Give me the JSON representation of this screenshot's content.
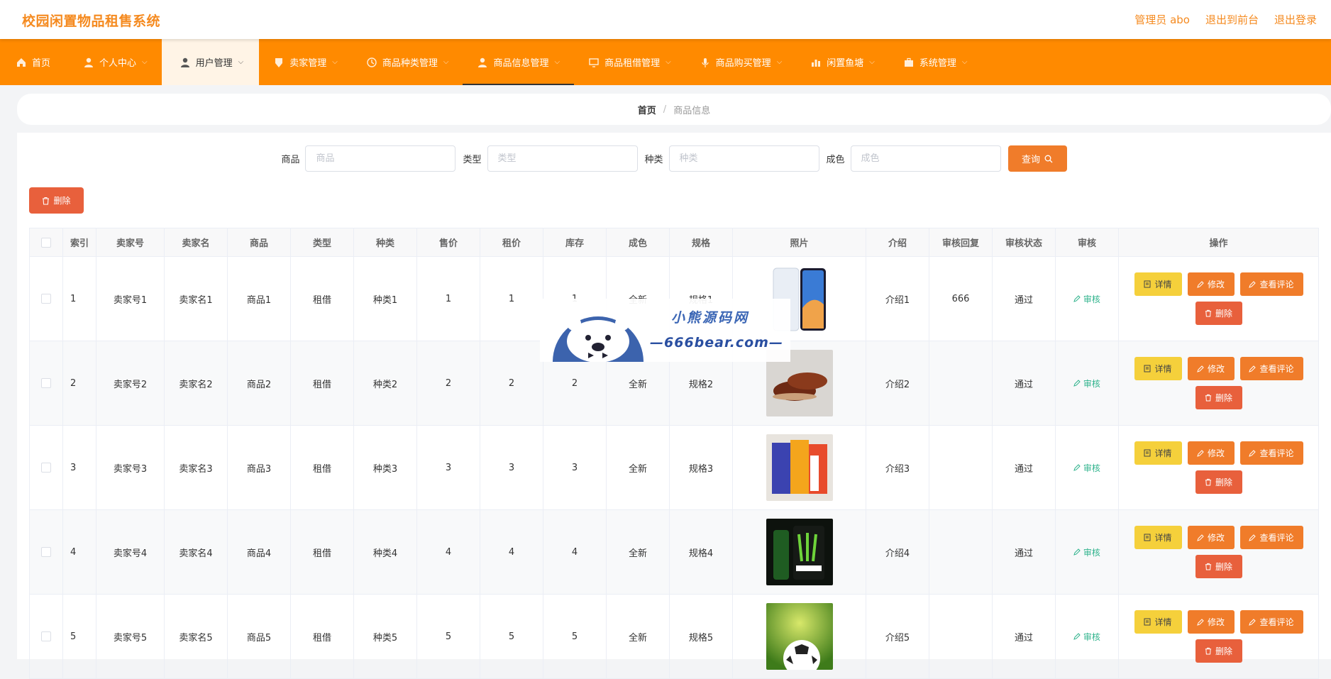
{
  "header": {
    "app_title": "校园闲置物品租售系统",
    "admin_label": "管理员 abo",
    "front_link": "退出到前台",
    "logout_link": "退出登录"
  },
  "nav": [
    {
      "label": "首页",
      "icon": "home-icon"
    },
    {
      "label": "个人中心",
      "icon": "user-icon"
    },
    {
      "label": "用户管理",
      "icon": "user-icon"
    },
    {
      "label": "卖家管理",
      "icon": "shield-icon"
    },
    {
      "label": "商品种类管理",
      "icon": "clock-icon"
    },
    {
      "label": "商品信息管理",
      "icon": "user-icon"
    },
    {
      "label": "商品租借管理",
      "icon": "monitor-icon"
    },
    {
      "label": "商品购买管理",
      "icon": "mic-icon"
    },
    {
      "label": "闲置鱼塘",
      "icon": "chart-icon"
    },
    {
      "label": "系统管理",
      "icon": "briefcase-icon"
    }
  ],
  "breadcrumb": {
    "home": "首页",
    "separator": "/",
    "current": "商品信息"
  },
  "search": {
    "fields": [
      {
        "label": "商品",
        "placeholder": "商品"
      },
      {
        "label": "类型",
        "placeholder": "类型"
      },
      {
        "label": "种类",
        "placeholder": "种类"
      },
      {
        "label": "成色",
        "placeholder": "成色"
      }
    ],
    "query_label": "查询"
  },
  "batch_delete_label": "删除",
  "table": {
    "columns": [
      "索引",
      "卖家号",
      "卖家名",
      "商品",
      "类型",
      "种类",
      "售价",
      "租价",
      "库存",
      "成色",
      "规格",
      "照片",
      "介绍",
      "审核回复",
      "审核状态",
      "审核",
      "操作"
    ],
    "rows": [
      {
        "index": "1",
        "seller_no": "卖家号1",
        "seller_name": "卖家名1",
        "product": "商品1",
        "type": "租借",
        "category": "种类1",
        "price": "1",
        "rent": "1",
        "stock": "1",
        "condition": "全新",
        "spec": "规格1",
        "photo": "phone",
        "intro": "介绍1",
        "reply": "666",
        "status": "通过",
        "audit": "审核"
      },
      {
        "index": "2",
        "seller_no": "卖家号2",
        "seller_name": "卖家名2",
        "product": "商品2",
        "type": "租借",
        "category": "种类2",
        "price": "2",
        "rent": "2",
        "stock": "2",
        "condition": "全新",
        "spec": "规格2",
        "photo": "shoes",
        "intro": "介绍2",
        "reply": "",
        "status": "通过",
        "audit": "审核"
      },
      {
        "index": "3",
        "seller_no": "卖家号3",
        "seller_name": "卖家名3",
        "product": "商品3",
        "type": "租借",
        "category": "种类3",
        "price": "3",
        "rent": "3",
        "stock": "3",
        "condition": "全新",
        "spec": "规格3",
        "photo": "cartons",
        "intro": "介绍3",
        "reply": "",
        "status": "通过",
        "audit": "审核"
      },
      {
        "index": "4",
        "seller_no": "卖家号4",
        "seller_name": "卖家名4",
        "product": "商品4",
        "type": "租借",
        "category": "种类4",
        "price": "4",
        "rent": "4",
        "stock": "4",
        "condition": "全新",
        "spec": "规格4",
        "photo": "can",
        "intro": "介绍4",
        "reply": "",
        "status": "通过",
        "audit": "审核"
      },
      {
        "index": "5",
        "seller_no": "卖家号5",
        "seller_name": "卖家名5",
        "product": "商品5",
        "type": "租借",
        "category": "种类5",
        "price": "5",
        "rent": "5",
        "stock": "5",
        "condition": "全新",
        "spec": "规格5",
        "photo": "ball",
        "intro": "介绍5",
        "reply": "",
        "status": "通过",
        "audit": "审核"
      }
    ],
    "actions": {
      "detail": "详情",
      "edit": "修改",
      "review": "查看评论",
      "delete": "删除"
    }
  },
  "watermark": {
    "line1": "小熊源码网",
    "line2": "—666bear.com—"
  },
  "colors": {
    "brand": "#ff8a00",
    "title": "#f58a1f",
    "danger": "#e8603c",
    "warning": "#f5d03b",
    "success": "#2fb38c"
  }
}
